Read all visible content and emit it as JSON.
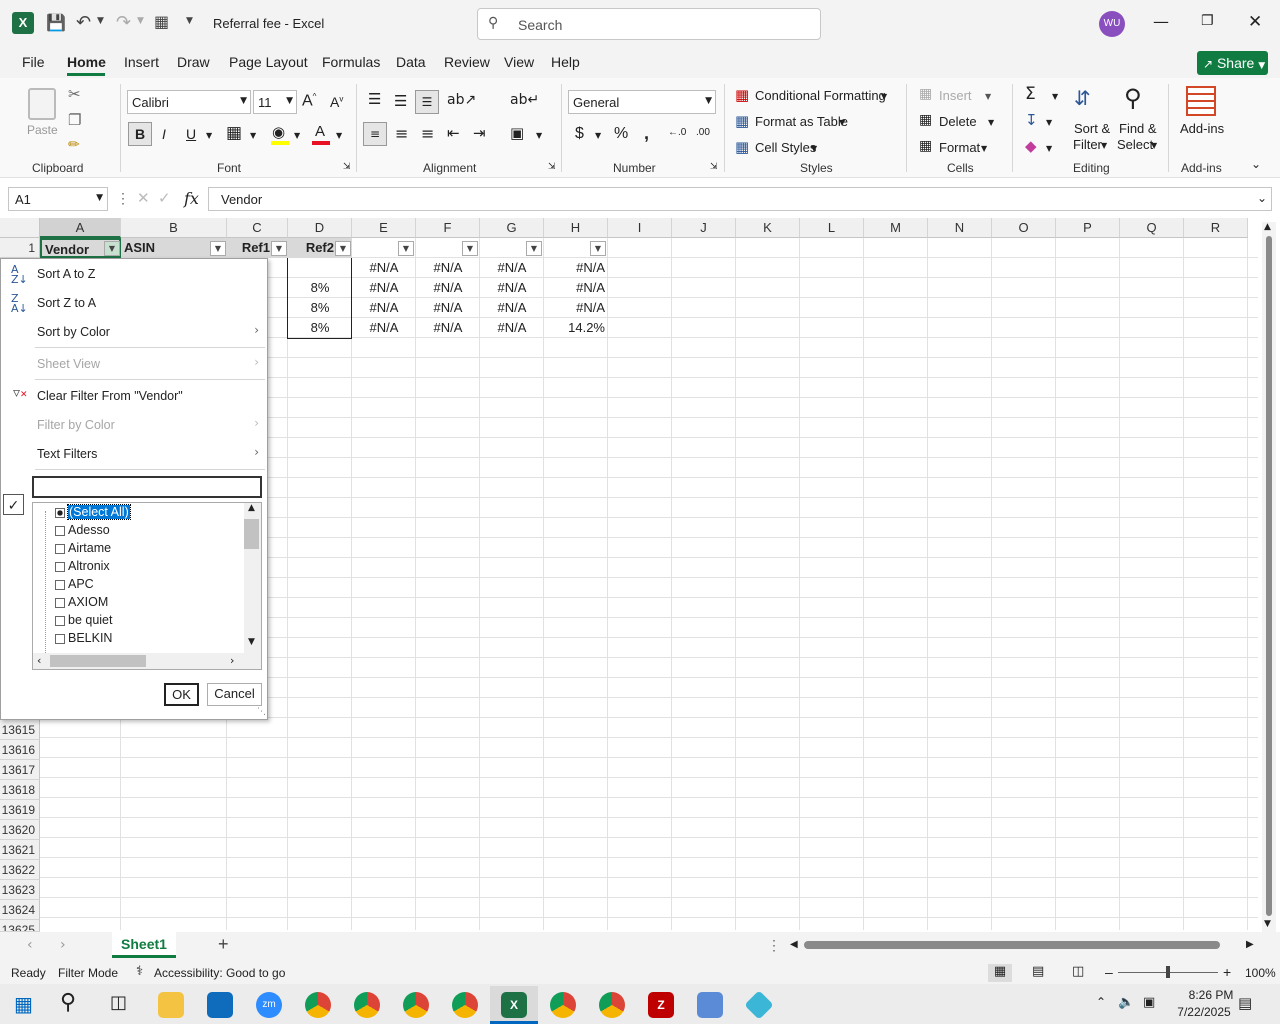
{
  "title": {
    "filename": "Referral fee",
    "sep": "-",
    "app": "Excel",
    "search_placeholder": "Search",
    "avatar": "WU"
  },
  "menu": [
    "File",
    "Home",
    "Insert",
    "Draw",
    "Page Layout",
    "Formulas",
    "Data",
    "Review",
    "View",
    "Help"
  ],
  "share_label": "Share",
  "ribbon": {
    "paste": "Paste",
    "font_name": "Calibri",
    "font_size": "11",
    "number_format": "General",
    "cond_fmt": "Conditional Formatting",
    "fmt_table": "Format as Table",
    "cell_styles": "Cell Styles",
    "insert": "Insert",
    "delete": "Delete",
    "format": "Format",
    "sort_filter_1": "Sort &",
    "sort_filter_2": "Filter",
    "find_select_1": "Find &",
    "find_select_2": "Select",
    "addins": "Add-ins",
    "groups": {
      "clipboard": "Clipboard",
      "font": "Font",
      "alignment": "Alignment",
      "number": "Number",
      "styles": "Styles",
      "cells": "Cells",
      "editing": "Editing",
      "addins": "Add-ins"
    }
  },
  "formula_bar": {
    "namebox": "A1",
    "content": "Vendor",
    "fx": "fx"
  },
  "columns": [
    "A",
    "B",
    "C",
    "D",
    "E",
    "F",
    "G",
    "H",
    "I",
    "J",
    "K",
    "L",
    "M",
    "N",
    "O",
    "P",
    "Q",
    "R"
  ],
  "header_row": {
    "num": "1",
    "a": "Vendor",
    "b": "ASIN",
    "c": "Ref1",
    "d": "Ref2"
  },
  "data_rows": [
    {
      "d": "",
      "e": "#N/A",
      "f": "#N/A",
      "g": "#N/A",
      "h": "#N/A"
    },
    {
      "d": "8%",
      "e": "#N/A",
      "f": "#N/A",
      "g": "#N/A",
      "h": "#N/A"
    },
    {
      "d": "8%",
      "e": "#N/A",
      "f": "#N/A",
      "g": "#N/A",
      "h": "#N/A"
    },
    {
      "d": "8%",
      "e": "#N/A",
      "f": "#N/A",
      "g": "#N/A",
      "h": "14.2%"
    }
  ],
  "visible_row_numbers": [
    "13615",
    "13616",
    "13617",
    "13618",
    "13619",
    "13620",
    "13621",
    "13622",
    "13623",
    "13624",
    "13625"
  ],
  "filter_menu": {
    "sort_az": "Sort A to Z",
    "sort_za": "Sort Z to A",
    "sort_color": "Sort by Color",
    "sheet_view": "Sheet View",
    "clear_filter": "Clear Filter From \"Vendor\"",
    "filter_color": "Filter by Color",
    "text_filters": "Text Filters",
    "search_value": "",
    "items": [
      "(Select All)",
      "Adesso",
      "Airtame",
      "Altronix",
      "APC",
      "AXIOM",
      "be quiet",
      "BELKIN"
    ],
    "ok": "OK",
    "cancel": "Cancel"
  },
  "sheet_tab": "Sheet1",
  "status": {
    "ready": "Ready",
    "mode": "Filter Mode",
    "accessibility": "Accessibility: Good to go",
    "zoom": "100%"
  },
  "clock": {
    "time": "8:26 PM",
    "date": "7/22/2025"
  },
  "colors": {
    "excel_green": "#1e7145",
    "share_green": "#107c41",
    "avatar": "#8a4fbf"
  }
}
